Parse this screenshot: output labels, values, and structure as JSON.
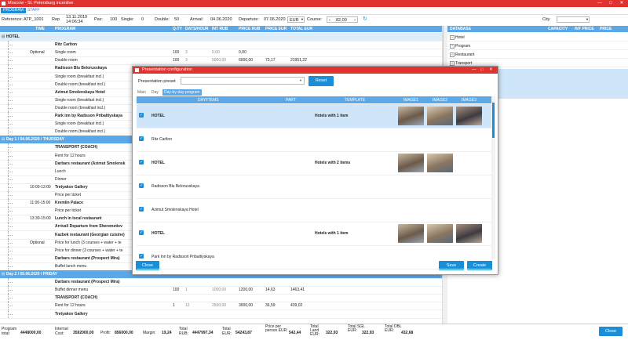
{
  "window": {
    "title": "Moscow - St. Petersburg incentive",
    "minimize": "—",
    "maximize": "□",
    "close": "✕"
  },
  "tabs": [
    "PROGRAM",
    "STAFF"
  ],
  "info": {
    "reference_label": "Reference:",
    "reference": "ATP_1001",
    "rep_label": "Rep",
    "rep_date": "13.11.2019",
    "rep_time": "14:06:34",
    "pax_label": "Pax:",
    "pax": "100",
    "single_label": "Single:",
    "single": "0",
    "double_label": "Double:",
    "double": "50",
    "arrival_label": "Arrival:",
    "arrival": "04.06.2020",
    "departure_label": "Departure:",
    "departure": "07.06.2020",
    "currency": "EUR",
    "course_label": "Course:",
    "course": "82,00",
    "city_label": "City"
  },
  "grid": {
    "headers": [
      "TIME",
      "PROGRAM",
      "Q-TY",
      "DAYS/HOUR",
      "INT RUB",
      "PRICE RUB",
      "PRICE EUR",
      "TOTAL EUR"
    ],
    "rows": [
      {
        "kind": "grp",
        "program": "HOTEL"
      },
      {
        "kind": "item",
        "program": "Ritz Carlton",
        "bold": true
      },
      {
        "kind": "item",
        "time": "Optional",
        "program": "Single room",
        "qty": "100",
        "days": "3",
        "int": "0,00",
        "price_rub": "0,00"
      },
      {
        "kind": "item",
        "program": "Double room",
        "qty": "100",
        "days": "3",
        "int": "5000,00",
        "price_rub": "6000,00",
        "price_eur": "73,17",
        "total": "21951,22"
      },
      {
        "kind": "item",
        "program": "Radisson Blu Belorusskaya",
        "bold": true
      },
      {
        "kind": "item",
        "program": "Single room (breakfast incl.)"
      },
      {
        "kind": "item",
        "program": "Double room (breakfast incl.)"
      },
      {
        "kind": "item",
        "program": "Azimut Smolenskaya Hotel",
        "bold": true
      },
      {
        "kind": "item",
        "program": "Single room (breakfast incl.)"
      },
      {
        "kind": "item",
        "program": "Double room (breakfast incl.)"
      },
      {
        "kind": "item",
        "program": "Park inn by Radisson Pribaltiyskaya",
        "bold": true
      },
      {
        "kind": "item",
        "program": "Single room (breakfast incl.)"
      },
      {
        "kind": "item",
        "program": "Double room (breakfast incl.)"
      },
      {
        "kind": "day",
        "program": "Day 1 / 04.06.2020 / THURSDAY"
      },
      {
        "kind": "item",
        "program": "TRANSPORT (COACH)",
        "bold": true
      },
      {
        "kind": "item",
        "program": "Rent for 12 hours"
      },
      {
        "kind": "item",
        "program": "Darbars restaurant (Azimut Smolensk",
        "bold": true
      },
      {
        "kind": "item",
        "program": "Lunch"
      },
      {
        "kind": "item",
        "program": "Dinner"
      },
      {
        "kind": "item",
        "time": "10:00-12:00",
        "program": "Tretyakov Gallery",
        "bold": true
      },
      {
        "kind": "item",
        "program": "Price per ticket"
      },
      {
        "kind": "item",
        "time": "11:00-15:00",
        "program": "Kremlin Palace",
        "bold": true
      },
      {
        "kind": "item",
        "program": "Price per ticket"
      },
      {
        "kind": "item",
        "time": "13:30-15:00",
        "program": "Lunch in local restaurant",
        "bold": true
      },
      {
        "kind": "item",
        "program": "Arrival/ Departure from Sheremetiev",
        "bold": true
      },
      {
        "kind": "item",
        "program": "Kazbek restaurant (Georgian cuisine)",
        "bold": true
      },
      {
        "kind": "item",
        "time": "Optional",
        "program": "Price for lunch (3 courses + water + te"
      },
      {
        "kind": "item",
        "program": "Price for dinner (3 courses + water + te"
      },
      {
        "kind": "item",
        "program": "Darbars restaurant (Prospect Mira)",
        "bold": true
      },
      {
        "kind": "item",
        "program": "Buffet lunch menu"
      },
      {
        "kind": "day",
        "program": "Day 2 / 05.06.2020 / FRIDAY"
      },
      {
        "kind": "item",
        "program": "Darbars restaurant (Prospect Mira)",
        "bold": true
      },
      {
        "kind": "item",
        "program": "Buffet dinner menu",
        "qty": "100",
        "days": "1",
        "int": "1000,00",
        "price_rub": "1200,00",
        "price_eur": "14,63",
        "total": "1463,41"
      },
      {
        "kind": "item",
        "program": "TRANSPORT (COACH)",
        "bold": true
      },
      {
        "kind": "item",
        "program": "Rent for 12 hours",
        "qty": "1",
        "days": "12",
        "int": "2500,00",
        "price_rub": "3000,00",
        "price_eur": "36,59",
        "total": "439,02"
      },
      {
        "kind": "item",
        "program": "Tretyakov Gallery",
        "bold": true
      }
    ]
  },
  "right_panel": {
    "headers": [
      "DATABASE",
      "CAPACITY",
      "INT PRICE",
      "PRICE"
    ],
    "items": [
      "Hotel",
      "Program",
      "Restaurant",
      "Transport"
    ]
  },
  "bottom": {
    "program_total_label": "Program total:",
    "program_total": "4448000,00",
    "internal_cost_label": "Internal Cost:",
    "internal_cost": "3592000,00",
    "profit_label": "Profit:",
    "profit": "856000,00",
    "margin_label": "Margin:",
    "margin": "19,24",
    "total_rub_label": "Total RUB:",
    "total_rub": "4447997,34",
    "total_eur_label": "Total EUR:",
    "total_eur": "54243,87",
    "price_per_person_label": "Price per person EUR:",
    "price_per_person": "542,44",
    "total_land_label": "Total Land EUR:",
    "total_land": "322,93",
    "total_sgl_label": "Total SGL EUR:",
    "total_sgl": "322,93",
    "total_dbl_label": "Total DBL EUR:",
    "total_dbl": "432,68",
    "close": "Close"
  },
  "modal": {
    "title": "Presentation configuration",
    "preset_label": "Presentation preset",
    "reset": "Reset",
    "tabs": [
      "Main",
      "Day",
      "Day-by-day program"
    ],
    "headers": [
      "DAY/ITEMS",
      "PART",
      "TEMPLATE",
      "IMAGE1",
      "IMAGE2",
      "IMAGE3"
    ],
    "rows": [
      {
        "name": "HOTEL",
        "bold": true,
        "template": "Hotels with 1 item",
        "images": 3,
        "highlight": true
      },
      {
        "name": "Ritz Carlton",
        "bold": false,
        "template": "",
        "images": 0
      },
      {
        "name": "HOTEL",
        "bold": true,
        "template": "Hotels with 2 items",
        "images": 2
      },
      {
        "name": "Radisson Blu Belorusskaya",
        "bold": false,
        "template": "",
        "images": 0
      },
      {
        "name": "Azimut Smolenskaya Hotel",
        "bold": false,
        "template": "",
        "images": 0
      },
      {
        "name": "HOTEL",
        "bold": true,
        "template": "Hotels with 1 item",
        "images": 3
      },
      {
        "name": "Park Inn by Radisson Pribaltiyskaya",
        "bold": false,
        "template": "",
        "images": 0
      }
    ],
    "close": "Close",
    "save": "Save",
    "create": "Create",
    "minimize": "—",
    "maximize": "□",
    "close_x": "✕"
  }
}
